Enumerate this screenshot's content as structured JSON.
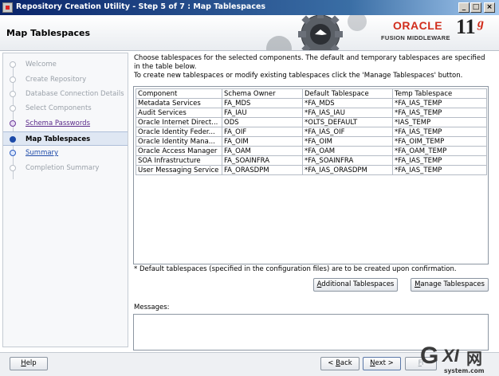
{
  "window": {
    "title": "Repository Creation Utility - Step 5 of 7 : Map Tablespaces"
  },
  "header": {
    "page_title": "Map Tablespaces",
    "brand_oracle": "ORACLE",
    "brand_fusion": "FUSION MIDDLEWARE",
    "version_number": "11",
    "version_letter": "g"
  },
  "nav": {
    "items": [
      {
        "label": "Welcome",
        "state": "done"
      },
      {
        "label": "Create Repository",
        "state": "done"
      },
      {
        "label": "Database Connection Details",
        "state": "done"
      },
      {
        "label": "Select Components",
        "state": "done"
      },
      {
        "label": "Schema Passwords",
        "state": "link"
      },
      {
        "label": "Map Tablespaces",
        "state": "current"
      },
      {
        "label": "Summary",
        "state": "next"
      },
      {
        "label": "Completion Summary",
        "state": "pending"
      }
    ]
  },
  "main": {
    "instructions": "Choose tablespaces for the selected components. The default and temporary tablespaces are specified in the table below.",
    "instructions2": "To create new tablespaces or modify existing tablespaces click the 'Manage Tablespaces' button.",
    "columns": [
      "Component",
      "Schema Owner",
      "Default Tablespace",
      "Temp Tablespace"
    ],
    "rows": [
      [
        "Metadata Services",
        "FA_MDS",
        "*FA_MDS",
        "*FA_IAS_TEMP"
      ],
      [
        "Audit Services",
        "FA_IAU",
        "*FA_IAS_IAU",
        "*FA_IAS_TEMP"
      ],
      [
        "Oracle Internet Direct...",
        "ODS",
        "*OLTS_DEFAULT",
        "*IAS_TEMP"
      ],
      [
        "Oracle Identity Feder...",
        "FA_OIF",
        "*FA_IAS_OIF",
        "*FA_IAS_TEMP"
      ],
      [
        "Oracle Identity Mana...",
        "FA_OIM",
        "*FA_OIM",
        "*FA_OIM_TEMP"
      ],
      [
        "Oracle Access Manager",
        "FA_OAM",
        "*FA_OAM",
        "*FA_OAM_TEMP"
      ],
      [
        "SOA Infrastructure",
        "FA_SOAINFRA",
        "*FA_SOAINFRA",
        "*FA_IAS_TEMP"
      ],
      [
        "User Messaging Service",
        "FA_ORASDPM",
        "*FA_IAS_ORASDPM",
        "*FA_IAS_TEMP"
      ]
    ],
    "note": "* Default tablespaces (specified in the configuration files) are to be created upon confirmation.",
    "additional_btn": {
      "mnemonic": "A",
      "rest": "dditional Tablespaces"
    },
    "manage_btn": {
      "mnemonic": "M",
      "rest": "anage Tablespaces"
    },
    "messages_label": "Messages:"
  },
  "footer": {
    "help_btn": {
      "mnemonic": "H",
      "rest": "elp"
    },
    "back_btn": {
      "pre": "< ",
      "mnemonic": "B",
      "rest": "ack"
    },
    "next_btn": {
      "mnemonic": "N",
      "rest": "ext >"
    },
    "finish_btn": {
      "mnemonic": "F",
      "rest": "i"
    }
  },
  "watermark": {
    "g": "G",
    "xi": "XI",
    "net": "网",
    "url": "system.com"
  },
  "icons": {
    "window": "app-icon",
    "minimize": "minimize-icon",
    "maximize": "maximize-icon",
    "close": "close-icon",
    "gear": "gear-icon"
  },
  "colors": {
    "oracle_red": "#d12d1c",
    "nav_current": "#dfe7f3",
    "title_blue": "#0a246a"
  }
}
